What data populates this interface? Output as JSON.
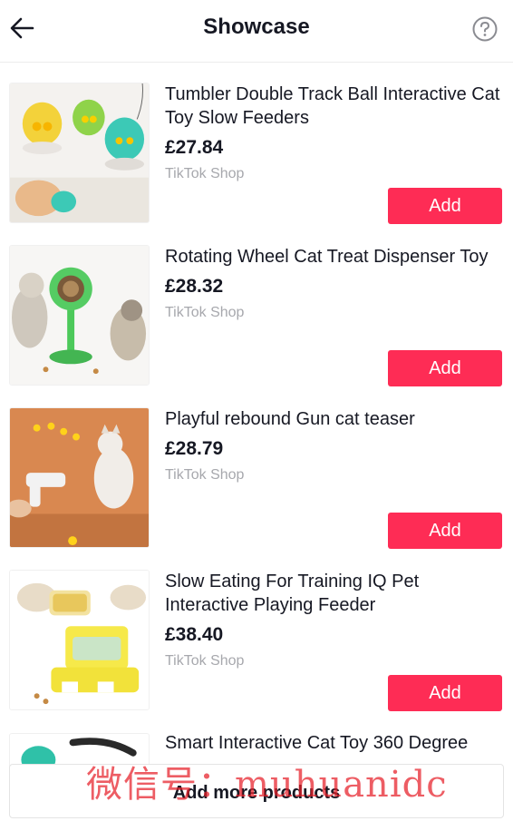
{
  "header": {
    "title": "Showcase",
    "back_icon": "arrow-left-icon",
    "help_icon": "question-circle-icon"
  },
  "products": [
    {
      "name": "Tumbler Double Track Ball Interactive Cat Toy Slow Feeders",
      "price": "£27.84",
      "shop": "TikTok Shop",
      "add_label": "Add"
    },
    {
      "name": "Rotating Wheel Cat Treat Dispenser Toy",
      "price": "£28.32",
      "shop": "TikTok Shop",
      "add_label": "Add"
    },
    {
      "name": "Playful rebound Gun cat teaser",
      "price": "£28.79",
      "shop": "TikTok Shop",
      "add_label": "Add"
    },
    {
      "name": "Slow Eating For Training IQ Pet Interactive Playing Feeder",
      "price": "£38.40",
      "shop": "TikTok Shop",
      "add_label": "Add"
    },
    {
      "name": "Smart Interactive Cat Toy 360 Degree"
    }
  ],
  "footer": {
    "add_more_label": "Add more products"
  },
  "watermark": "微信号：muhuanidc",
  "colors": {
    "accent": "#fe2c55",
    "text": "#161823",
    "muted": "#a7a8ad"
  }
}
